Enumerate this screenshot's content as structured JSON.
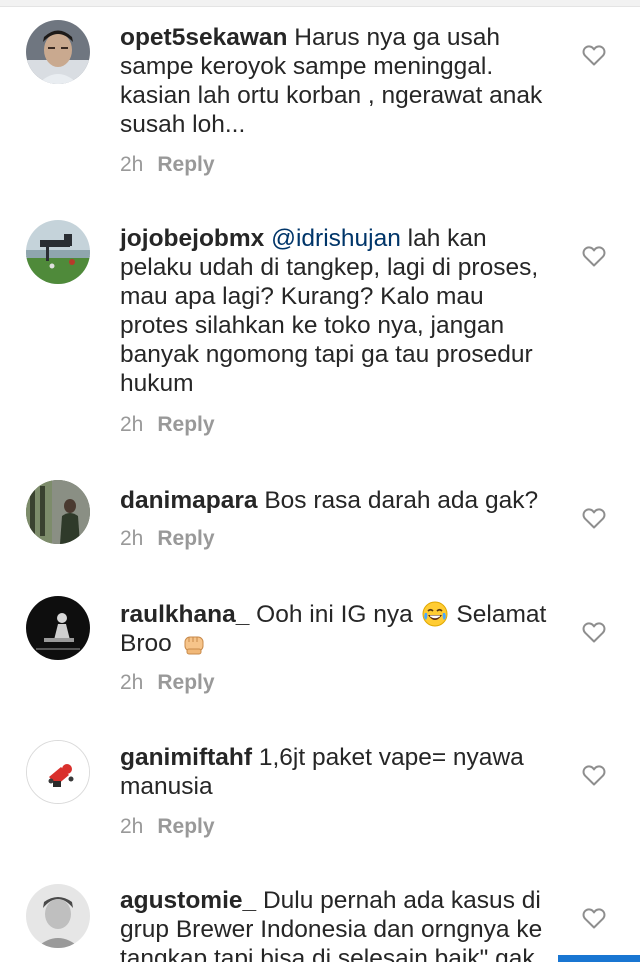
{
  "comments": [
    {
      "username": "opet5sekawan",
      "mention": "",
      "text": " Harus nya ga usah\nsampe keroyok sampe meninggal.\nkasian lah ortu korban , ngerawat anak\nsusah loh...",
      "text_after_emoji": "",
      "text_after_emoji2": "",
      "time": "2h",
      "reply_label": "Reply",
      "avatar_icon": "profile-photo"
    },
    {
      "username": "jojobejobmx",
      "mention": "@idrishujan",
      "text": " lah kan\npelaku udah di tangkep, lagi di proses,\nmau apa lagi? Kurang? Kalo mau\nprotes silahkan ke toko nya, jangan\nbanyak ngomong tapi ga tau prosedur\nhukum",
      "text_after_emoji": "",
      "text_after_emoji2": "",
      "time": "2h",
      "reply_label": "Reply",
      "avatar_icon": "profile-photo"
    },
    {
      "username": "danimapara",
      "mention": "",
      "text": " Bos rasa darah ada gak?",
      "text_after_emoji": "",
      "text_after_emoji2": "",
      "time": "2h",
      "reply_label": "Reply",
      "avatar_icon": "profile-photo"
    },
    {
      "username": "raulkhana_",
      "mention": "",
      "text": " Ooh ini IG nya ",
      "text_after_emoji": " Selamat\nBroo ",
      "text_after_emoji2": "",
      "time": "2h",
      "reply_label": "Reply",
      "avatar_icon": "profile-photo",
      "emoji_1": "tears-of-joy-emoji",
      "emoji_2": "fist-bump-emoji"
    },
    {
      "username": "ganimiftahf",
      "mention": "",
      "text": " 1,6jt paket vape= nyawa\nmanusia",
      "text_after_emoji": "",
      "text_after_emoji2": "",
      "time": "2h",
      "reply_label": "Reply",
      "avatar_icon": "profile-photo"
    },
    {
      "username": "agustomie_",
      "mention": "",
      "text": " Dulu pernah ada kasus di\ngrup Brewer Indonesia dan orngnya ke\ntangkap tapi bisa di selesain baik\" gak",
      "text_after_emoji": "",
      "text_after_emoji2": "",
      "time": "",
      "reply_label": "",
      "avatar_icon": "profile-photo"
    }
  ],
  "icons": {
    "like": "heart-outline-icon"
  },
  "colors": {
    "text": "#262626",
    "meta": "#999999",
    "mention": "#003569",
    "accent_bar": "#1976d2"
  }
}
